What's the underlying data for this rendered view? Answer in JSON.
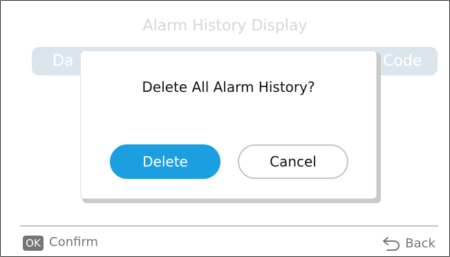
{
  "screen": {
    "title": "Alarm History Display",
    "header": {
      "col_date": "Da",
      "col_code": "Code"
    }
  },
  "dialog": {
    "message": "Delete All Alarm History?",
    "delete_label": "Delete",
    "cancel_label": "Cancel"
  },
  "footer": {
    "ok_badge": "OK",
    "confirm_label": "Confirm",
    "back_label": "Back",
    "back_icon": "return-arrow-icon"
  },
  "colors": {
    "accent": "#1c9fe0",
    "muted_text": "#757575"
  }
}
